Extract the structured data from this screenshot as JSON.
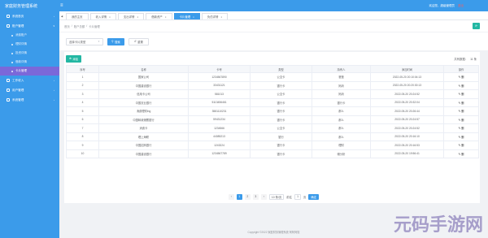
{
  "app": {
    "title": "家庭财务管理系统",
    "user_text": "欢迎您，超级管理员",
    "exit_label": "退出",
    "hamburger_glyph": "≡"
  },
  "sidebar": {
    "items": [
      {
        "label": "系统首页",
        "expandable": true
      },
      {
        "label": "账户管理",
        "expandable": true,
        "expanded": true,
        "children": [
          {
            "label": "消费账户",
            "active": false
          },
          {
            "label": "理财详情",
            "active": false
          },
          {
            "label": "投资详情",
            "active": false
          },
          {
            "label": "借款详情",
            "active": false
          },
          {
            "label": "卡片管理",
            "active": true
          }
        ]
      },
      {
        "label": "工作收入",
        "expandable": true
      },
      {
        "label": "用户管理",
        "expandable": true
      },
      {
        "label": "系统管理",
        "expandable": true
      }
    ]
  },
  "tabs": {
    "items": [
      {
        "label": "我的主页",
        "active": false,
        "closable": false
      },
      {
        "label": "收入详情",
        "active": false,
        "closable": true
      },
      {
        "label": "支出详情",
        "active": false,
        "closable": true
      },
      {
        "label": "借款资产",
        "active": false,
        "closable": true
      },
      {
        "label": "卡片管理",
        "active": true,
        "closable": true
      },
      {
        "label": "负债详情",
        "active": false,
        "closable": true
      }
    ]
  },
  "breadcrumb": {
    "items": [
      "首页",
      "账户总额",
      "卡片管理"
    ]
  },
  "filter": {
    "select_value": "选择卡片类型",
    "search_label": "搜索",
    "reset_label": "重置"
  },
  "toolbar": {
    "add_label": "添加",
    "right_label": "共有数据：",
    "right_count": "11 条"
  },
  "table": {
    "columns": [
      "序号",
      "名称",
      "卡号",
      "类型",
      "持有人",
      "添加时间",
      "操作"
    ],
    "rows": [
      [
        "1",
        "国家公司",
        "1234567890",
        "公交卡",
        "爸爸",
        "2022-05-20 20:10:04:13"
      ],
      [
        "2",
        "中国建设银行",
        "33431121",
        "银行卡",
        "妈妈",
        "2022-05-20 20:20:30:13"
      ],
      [
        "3",
        "信用卡公司",
        "581013",
        "公交卡",
        "妈妈",
        "2022-05-20 20:24:52"
      ],
      [
        "4",
        "中国农业银行",
        "5113456461",
        "银行卡",
        "银行卡",
        "2022-05-20 20:32:04"
      ],
      [
        "5",
        "消费理财ing",
        "3581110231",
        "银行卡",
        "那么",
        "2022-05-20 20:26:44"
      ],
      [
        "6",
        "中国邮政储蓄银行",
        "59431234",
        "银行卡",
        "那么",
        "2022-05-20 20:24:57"
      ],
      [
        "7",
        "消费卡",
        "1234566",
        "公交卡",
        "那么",
        "2022-05-20 20:24:52"
      ],
      [
        "8",
        "理上海联",
        "44085213",
        "银行",
        "那么",
        "2022-05-20 20:16:10"
      ],
      [
        "9",
        "中国招商银行",
        "1243224",
        "银行卡",
        "理财",
        "2022-05-20 20:16:53"
      ],
      [
        "10",
        "中国建设银行",
        "1234567789",
        "银行卡",
        "储分析",
        "2022-05-20 19:56:41"
      ]
    ],
    "ops_glyph": "✎ 删"
  },
  "pagination": {
    "pages": [
      "1",
      "2",
      "3"
    ],
    "current": "1",
    "prev": "‹",
    "next": "›",
    "page_size": "10 条/页",
    "goto_prefix": "前往",
    "goto_value": "1",
    "goto_suffix": "页",
    "go_label": "确定"
  },
  "footer": {
    "text": "Copyright ©2022 家庭财务管理系统 阿阿阿权"
  },
  "watermark": "元码手游网",
  "colors": {
    "primary": "#3b9bea",
    "teal": "#23b7a3",
    "active_menu": "#7b68d9",
    "exit": "#ff5a5a"
  }
}
